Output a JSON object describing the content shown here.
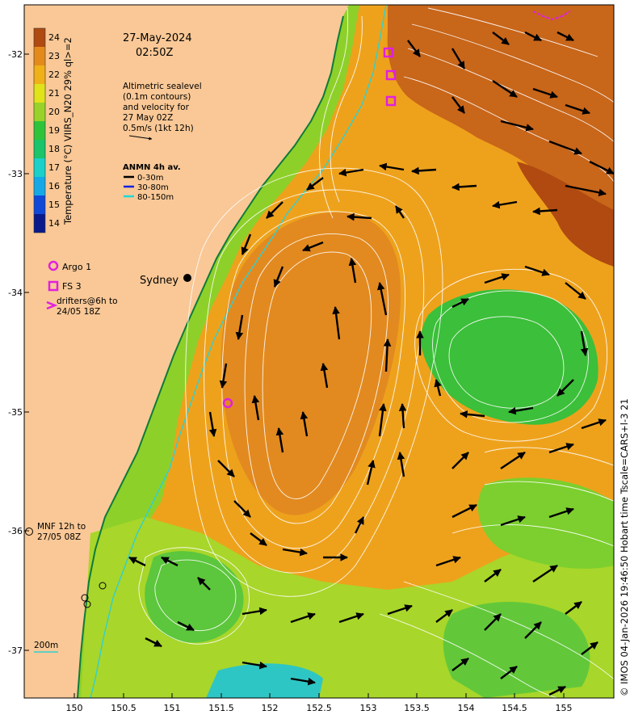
{
  "header": {
    "date": "27-May-2024",
    "time": "02:50Z"
  },
  "colorbar": {
    "label": "Temperature (°C) VIIRS_N20 29% ql>=2",
    "ticks": [
      "14",
      "15",
      "16",
      "17",
      "18",
      "19",
      "20",
      "21",
      "22",
      "23",
      "24"
    ],
    "colors": [
      "#0a1a8a",
      "#1048d8",
      "#15a8e6",
      "#1ad0c8",
      "#19c46a",
      "#2fc33a",
      "#9ad22a",
      "#e0e21a",
      "#f0b018",
      "#e48a1a",
      "#b04a10"
    ]
  },
  "altimetry_note": {
    "lines": [
      "Altimetric sealevel",
      "(0.1m contours)",
      "and velocity for",
      "27 May 02Z",
      "0.5m/s (1kt 12h)"
    ]
  },
  "anmn_legend": {
    "title": "ANMN 4h av.",
    "items": [
      {
        "label": "0-30m",
        "color": "#000000"
      },
      {
        "label": "30-80m",
        "color": "#1020e0"
      },
      {
        "label": "80-150m",
        "color": "#20d8d8"
      }
    ]
  },
  "platforms": {
    "argo_label": "Argo 1",
    "fs_label": "FS 3",
    "drifters_label_1": "drifters@6h to",
    "drifters_label_2": "24/05 18Z",
    "mnf_label_1": "MNF 12h to",
    "mnf_label_2": "27/05 08Z",
    "marker_color": "#e020e0"
  },
  "place": {
    "sydney": "Sydney"
  },
  "scale": {
    "isobath": "200m"
  },
  "axes": {
    "lon_ticks": [
      "150",
      "150.5",
      "151",
      "151.5",
      "152",
      "152.5",
      "153",
      "153.5",
      "154",
      "154.5",
      "155"
    ],
    "lat_ticks": [
      "-32",
      "-33",
      "-34",
      "-35",
      "-36",
      "-37"
    ]
  },
  "credit": "© IMOS 04-Jan-2026 19:46:50 Hobart time Tscale=CARS+l-3 21"
}
